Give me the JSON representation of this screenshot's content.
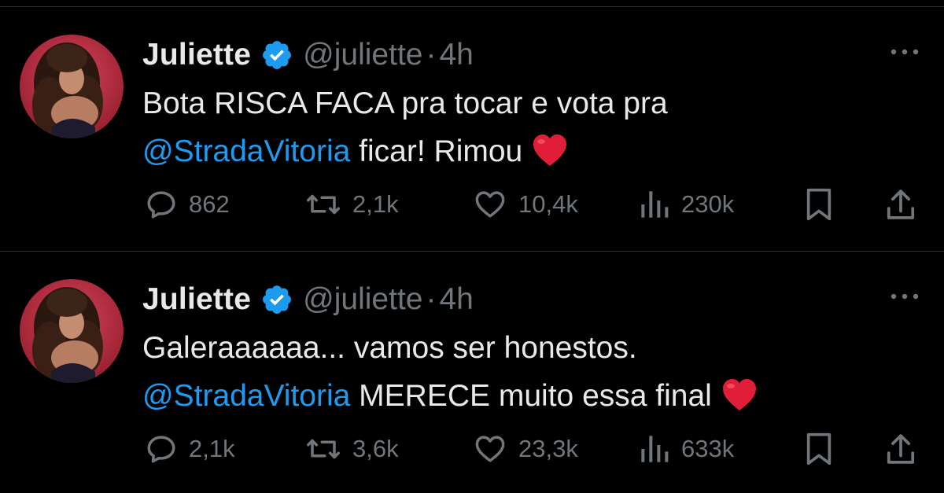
{
  "colors": {
    "background": "#000000",
    "text": "#e7e9ea",
    "muted": "#71767b",
    "mention": "#1d9bf0",
    "verified_badge": "#1d9bf0",
    "divider": "#2f3336",
    "heart_emoji": "#e01e37"
  },
  "tweets": [
    {
      "author": {
        "name": "Juliette",
        "handle": "@juliette",
        "verified_icon": "verified-badge-icon"
      },
      "separator": "·",
      "time": "4h",
      "text": {
        "line1": "Bota RISCA FACA pra tocar e vota pra",
        "mention": "@StradaVitoria",
        "line2_rest": " ficar! Rimou"
      },
      "emoji": "red-heart",
      "stats": {
        "replies": "862",
        "retweets": "2,1k",
        "likes": "10,4k",
        "views": "230k"
      }
    },
    {
      "author": {
        "name": "Juliette",
        "handle": "@juliette",
        "verified_icon": "verified-badge-icon"
      },
      "separator": "·",
      "time": "4h",
      "text": {
        "line1": "Galeraaaaaa... vamos ser honestos.",
        "mention": "@StradaVitoria",
        "line2_rest": " MERECE muito essa final"
      },
      "emoji": "red-heart",
      "stats": {
        "replies": "2,1k",
        "retweets": "3,6k",
        "likes": "23,3k",
        "views": "633k"
      }
    }
  ]
}
